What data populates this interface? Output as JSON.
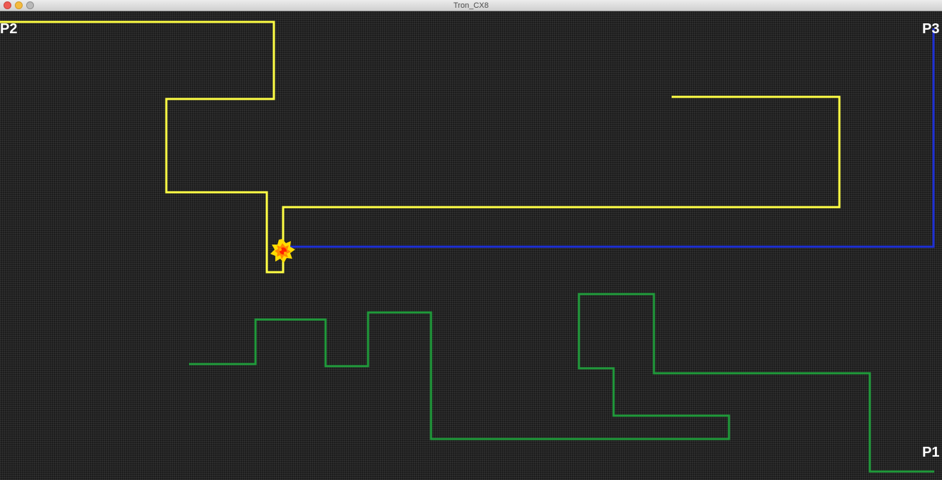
{
  "window": {
    "title": "Tron_CX8"
  },
  "players": [
    {
      "label": "P1",
      "color": "#1f9a3a",
      "trail_name": "player1-green-trail"
    },
    {
      "label": "P2",
      "color": "#ffff44",
      "trail_name": "player2-yellow-trail"
    },
    {
      "label": "P3",
      "color": "#1d2fd6",
      "trail_name": "player3-blue-trail"
    }
  ],
  "effects": {
    "explosion_icon": "explosion-icon",
    "explosion_colors": [
      "#ffdd00",
      "#ff8800",
      "#ff2200"
    ]
  }
}
